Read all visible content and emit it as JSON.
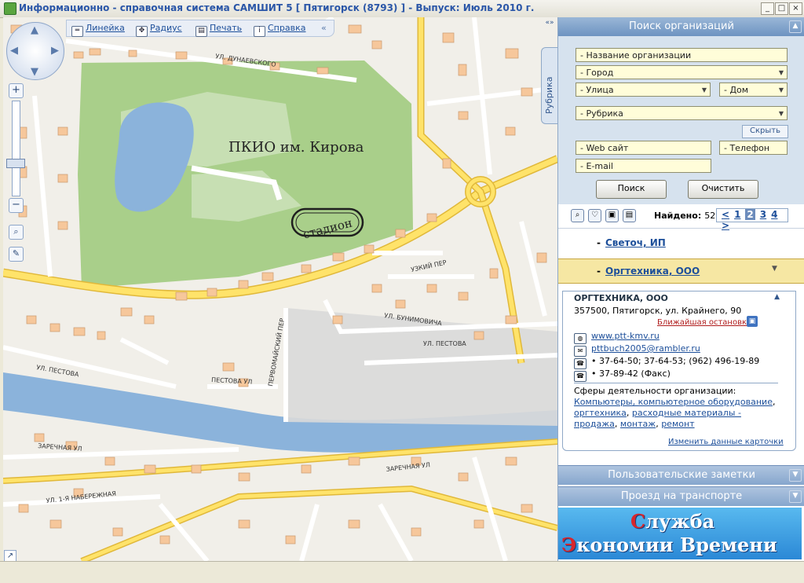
{
  "window": {
    "title": "Информационно - справочная система САМШИТ 5  [ Пятигорск (8793) ]  -  Выпуск:  Июль 2010 г.",
    "buttons": {
      "minimize": "_",
      "maximize": "□",
      "close": "×"
    }
  },
  "map_toolbar": {
    "ruler": "Линейка",
    "radius": "Радиус",
    "print": "Печать",
    "help": "Справка"
  },
  "zoom": {
    "plus": "+",
    "minus": "−"
  },
  "map": {
    "park_label": "ПКИО им. Кирова",
    "stadium_label": "стадион",
    "streets": {
      "dunaevsky": "УЛ. ДУНАЕВСКОГО",
      "pestova": "УЛ. ПЕСТОВА",
      "pestova2": "УЛ. ПЕСТОВА",
      "pestova_ul": "ПЕСТОВА УЛ",
      "zarechnaya": "ЗАРЕЧНАЯ УЛ",
      "zarechnaya2": "ЗАРЕЧНАЯ УЛ",
      "bunimovicha": "УЛ. БУНИМОВИЧА",
      "uzkiy": "УЗКИЙ ПЕР",
      "naberezhnaya": "УЛ. 1-Я НАБЕРЕЖНАЯ",
      "pervomaysky": "ПЕРВОМАЙСКИЙ ПЕР"
    }
  },
  "sidetab": {
    "label": "Рубрика",
    "collapse": "«»"
  },
  "search": {
    "header": "Поиск организаций",
    "name_ph": "- Название организации",
    "city_ph": "- Город",
    "street_ph": "- Улица",
    "house_ph": "- Дом",
    "rubric_ph": "- Рубрика",
    "hide": "Скрыть",
    "web_ph": "- Web сайт",
    "phone_ph": "- Телефон",
    "email_ph": "- E-mail",
    "search_btn": "Поиск",
    "clear_btn": "Очистить"
  },
  "results": {
    "found_label": "Найдено:",
    "found_count": "52",
    "pages": [
      "<",
      "1",
      "2",
      "3",
      "4",
      ">"
    ],
    "current_page": "2",
    "items": [
      "Светоч, ИП",
      "Оргтехника, ООО"
    ]
  },
  "card": {
    "title": "ОРГТЕХНИКА, ООО",
    "address": "357500, Пятигорск, ул. Крайнего, 90",
    "stop_link": "Ближайшая остановка",
    "website": "www.ptt-kmv.ru",
    "email": "pttbuch2005@rambler.ru",
    "phones": "• 37-64-50; 37-64-53; (962) 496-19-89",
    "fax": "• 37-89-42 (Факс)",
    "activities_label": "Сферы деятельности организации:",
    "activities": [
      "Компьютеры, компьютерное оборудование",
      "оргтехника",
      "расходные материалы - продажа",
      "монтаж",
      "ремонт"
    ],
    "edit_link": "Изменить данные карточки"
  },
  "accordions": {
    "notes": "Пользовательские заметки",
    "transport": "Проезд на транспорте"
  },
  "ad": {
    "line1": "Служба",
    "line2": "Экономии Времени"
  },
  "colors": {
    "map_bg": "#f1efe9",
    "road": "#ffe36a",
    "park": "#a9cf8a",
    "water": "#8bb3db",
    "panel_head": "#7fa1c9",
    "link": "#1d4f9a"
  }
}
